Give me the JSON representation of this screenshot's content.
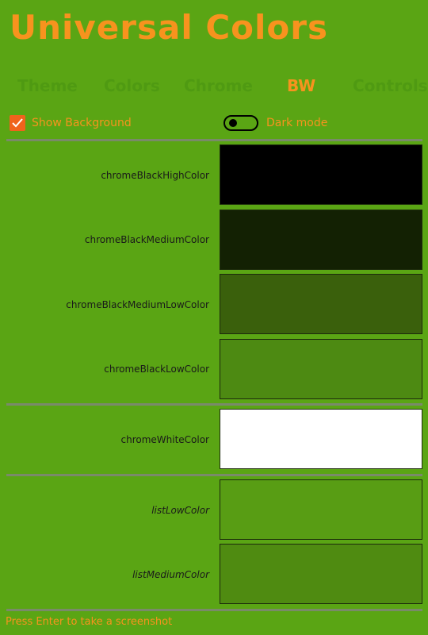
{
  "app": {
    "title": "Universal Colors"
  },
  "tabs": [
    {
      "label": "Theme",
      "active": false
    },
    {
      "label": "Colors",
      "active": false
    },
    {
      "label": "Chrome",
      "active": false
    },
    {
      "label": "BW",
      "active": true
    },
    {
      "label": "Controls",
      "active": false
    }
  ],
  "options": {
    "show_background": {
      "label": "Show Background",
      "checked": true
    },
    "dark_mode": {
      "label": "Dark mode",
      "on": false
    }
  },
  "rows": [
    {
      "label": "chromeBlackHighColor",
      "color": "#000000"
    },
    {
      "label": "chromeBlackMediumColor",
      "color": "#132103"
    },
    {
      "label": "chromeBlackMediumLowColor",
      "color": "#3a600c"
    },
    {
      "label": "chromeBlackLowColor",
      "color": "#4d8a12"
    },
    {
      "label": "chromeWhiteColor",
      "color": "#ffffff"
    },
    {
      "label": "listLowColor",
      "color": "#589d14"
    },
    {
      "label": "listMediumColor",
      "color": "#4f8b11"
    }
  ],
  "footer": {
    "hint": "Press Enter to take a screenshot"
  },
  "colors": {
    "background": "#5aa514",
    "accent": "#f7931e",
    "checkbox": "#f0631c"
  }
}
